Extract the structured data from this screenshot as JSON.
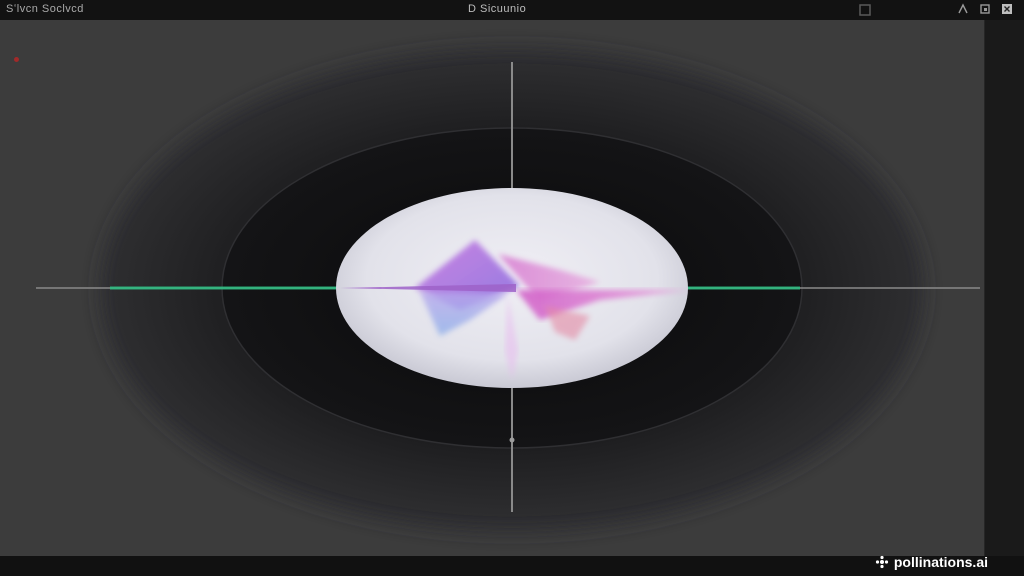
{
  "window": {
    "app_title": "Sʻlvcn Soclvcd",
    "document_title": "D Sicuunio"
  },
  "viewport": {
    "background_color": "#3c3c3c",
    "lens_colors": [
      "#e6e6ee",
      "#b86ad9",
      "#e27bcc",
      "#a89be6"
    ],
    "axis_accent_color": "#2bbf82"
  },
  "icons": {
    "titlebar_left_icon": "square-icon",
    "window_controls": [
      "settings-icon",
      "layers-icon",
      "close-icon"
    ]
  },
  "watermark": {
    "text": "pollinations.ai"
  }
}
